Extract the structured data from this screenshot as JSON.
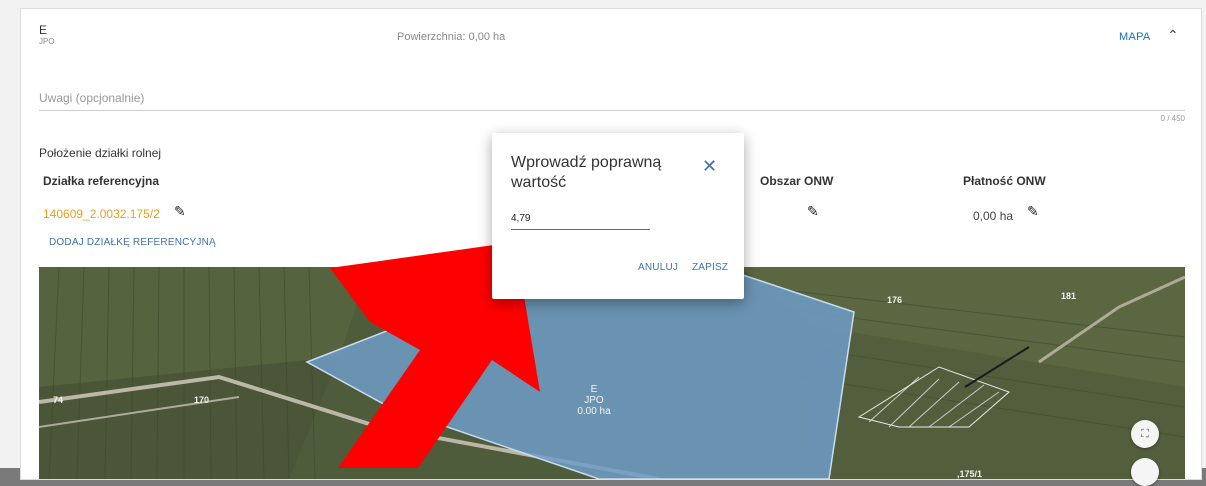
{
  "header": {
    "letter": "E",
    "sub": "JPO",
    "area": "Powierzchnia: 0,00 ha",
    "map_toggle": "MAPA",
    "chevron_icon": "chevron-up-icon"
  },
  "notes": {
    "placeholder": "Uwagi (opcjonalnie)",
    "counter": "0 / 450"
  },
  "location": {
    "section_label": "Położenie działki rolnej",
    "columns": {
      "reference": "Działka referencyjna",
      "onw_area": "Obszar ONW",
      "onw_payment": "Płatność ONW"
    },
    "reference_value": "140609_2.0032.175/2",
    "onw_payment_value": "0,00 ha",
    "add_reference": "DODAJ DZIAŁKĘ REFERENCYJNĄ"
  },
  "map": {
    "plot_letter": "E",
    "plot_sub": "JPO",
    "plot_area": "0.00 ha",
    "parcel_numbers": [
      "74",
      "170",
      "176",
      "181",
      ",175/1"
    ],
    "fullscreen_icon": "fullscreen-icon"
  },
  "dialog": {
    "title": "Wprowadź poprawną wartość",
    "input_value": "4,79",
    "cancel_label": "ANULUJ",
    "save_label": "ZAPISZ",
    "close_icon": "close-icon"
  },
  "colors": {
    "accent": "#3d74ad",
    "reference_value": "#e5a024",
    "arrow": "#ff0000",
    "plot_fill": "#6f9cc8"
  }
}
